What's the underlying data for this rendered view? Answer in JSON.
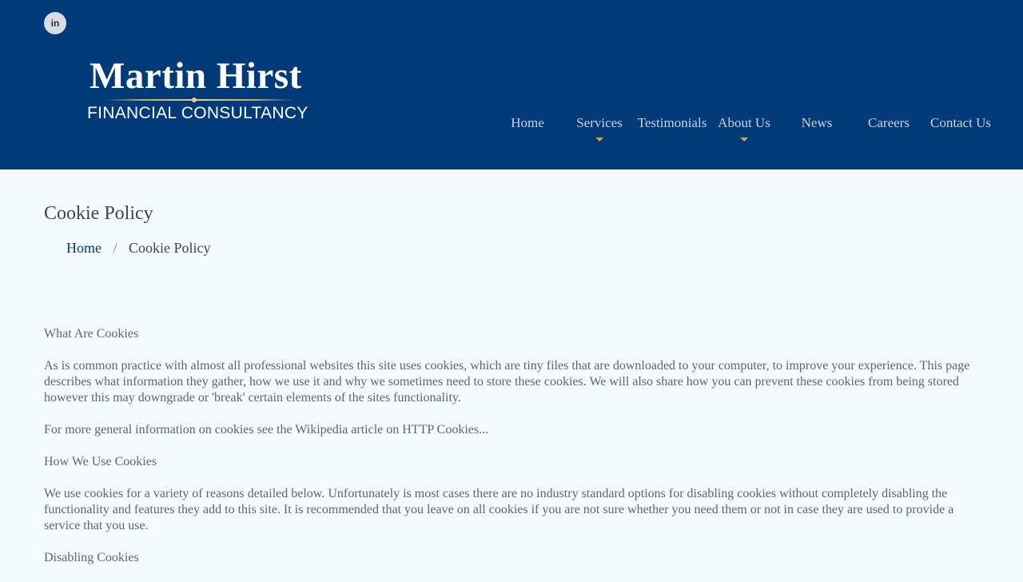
{
  "header": {
    "social": {
      "label": "in",
      "icon": "linkedin-icon"
    },
    "logo": {
      "name": "Martin Hirst",
      "subtitle": "FINANCIAL CONSULTANCY"
    },
    "nav": [
      {
        "label": "Home",
        "has_dropdown": false
      },
      {
        "label": "Services",
        "has_dropdown": true
      },
      {
        "label": "Testimonials",
        "has_dropdown": false
      },
      {
        "label": "About Us",
        "has_dropdown": true
      },
      {
        "label": "News",
        "has_dropdown": false
      },
      {
        "label": "Careers",
        "has_dropdown": false
      },
      {
        "label": "Contact Us",
        "has_dropdown": false
      }
    ]
  },
  "page": {
    "title": "Cookie Policy",
    "breadcrumb": {
      "home": "Home",
      "separator": "/",
      "current": "Cookie Policy"
    }
  },
  "content": {
    "paragraphs": [
      "What Are Cookies",
      "As is common practice with almost all professional websites this site uses cookies, which are tiny files that are downloaded to your computer, to improve your experience. This page describes what information they gather, how we use it and why we sometimes need to store these cookies. We will also share how you can prevent these cookies from being stored however this may downgrade or 'break' certain elements of the sites functionality.",
      "For more general information on cookies see the Wikipedia article on HTTP Cookies...",
      "How We Use Cookies",
      "We use cookies for a variety of reasons detailed below. Unfortunately is most cases there are no industry standard options for disabling cookies without completely disabling the functionality and features they add to this site. It is recommended that you leave on all cookies if you are not sure whether you need them or not in case they are used to provide a service that you use.",
      "Disabling Cookies"
    ]
  },
  "colors": {
    "header_bg": "#003a79",
    "page_bg": "#f3fbfd",
    "accent_gold": "#c9a85c",
    "link": "#003a79"
  }
}
